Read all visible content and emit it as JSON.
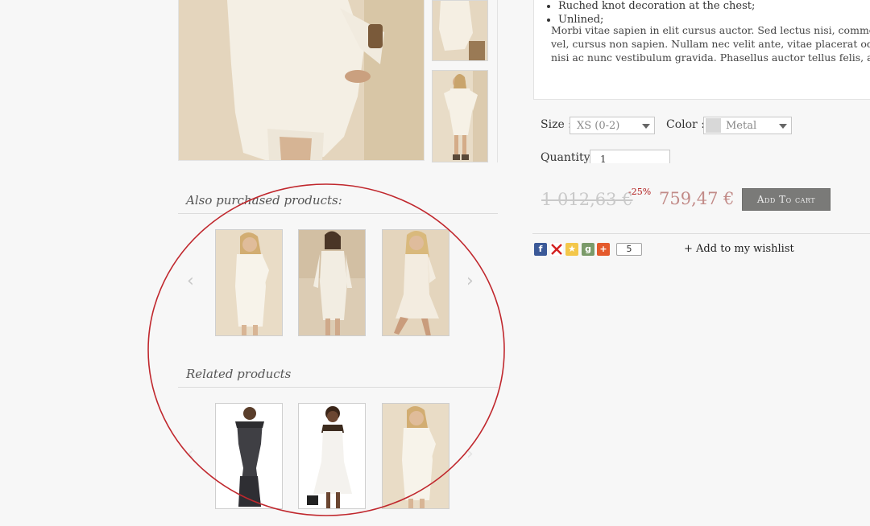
{
  "description": {
    "bullets": [
      "Ruched knot decoration at the chest;",
      "Unlined;"
    ],
    "paragraph_lines": [
      "Morbi vitae sapien in elit cursus auctor. Sed lectus nisi, commodo vel",
      "vel, cursus non sapien. Nullam nec velit ante, vitae placerat odio. Dui",
      "nisi ac nunc vestibulum gravida. Phasellus auctor tellus felis, ac curs"
    ]
  },
  "options": {
    "size_label": "Size :",
    "size_value": "XS (0-2)",
    "color_label": "Color :",
    "color_value": "Metal",
    "color_swatch": "#d8d8d8",
    "quantity_label": "Quantity:",
    "quantity_value": "1"
  },
  "pricing": {
    "old_price": "1 012,63 €",
    "discount": "-25%",
    "new_price": "759,47 €",
    "add_to_cart": "Add To cart"
  },
  "social": {
    "icons": [
      "facebook-icon",
      "twitter-icon",
      "favorite-star-icon",
      "google-plus-icon",
      "share-plus-icon"
    ],
    "count": "5",
    "wishlist_label": "+ Add to my wishlist"
  },
  "also_purchased": {
    "title": "Also purchased products:",
    "prev": "‹",
    "next": "›"
  },
  "related": {
    "title": "Related products",
    "prev": "‹",
    "next": "›"
  },
  "colors": {
    "annotation": "#c0272d",
    "button": "#7a7a78",
    "price": "#c28b88"
  }
}
